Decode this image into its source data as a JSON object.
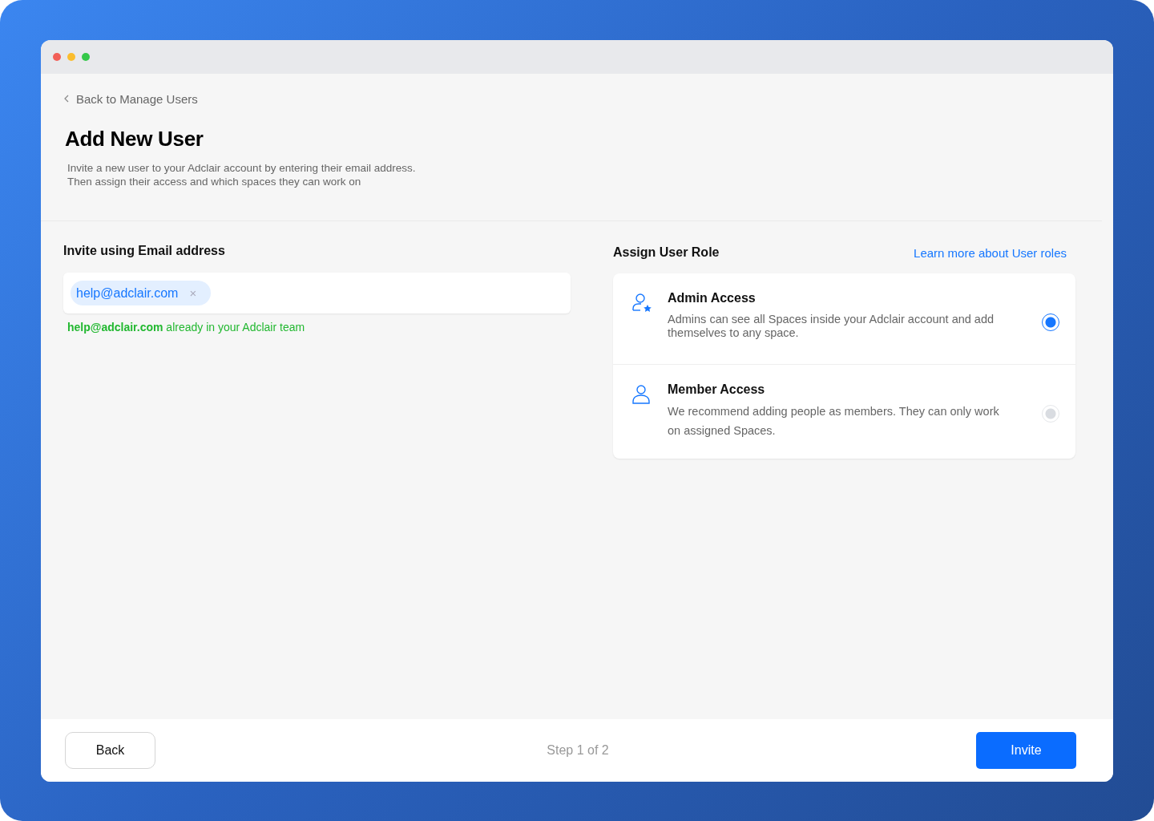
{
  "back_link": "Back to Manage Users",
  "title": "Add New User",
  "description": [
    "Invite a new user to your Adclair account by entering their email address.",
    "Then assign their access and which spaces they can work on"
  ],
  "invite": {
    "heading": "Invite using Email address",
    "chips": [
      {
        "email": "help@adclair.com",
        "remove": "×"
      }
    ],
    "message": "**help@adclair.com** already in your Adclair team"
  },
  "roles_section": {
    "heading": "Assign User Role",
    "link": "Learn more about User roles"
  },
  "roles": [
    {
      "kind": "admin",
      "title": "Admin Access",
      "description": "Admins can see all Spaces inside your Adclair account and add themselves to any space.",
      "selected": true
    },
    {
      "kind": "member",
      "title": "Member Access",
      "description": "We recommend adding people as members. They can only work on assigned Spaces.",
      "selected": false
    }
  ],
  "footer": {
    "back": "Back",
    "step": "Step 1 of 2",
    "invite": "Invite"
  }
}
